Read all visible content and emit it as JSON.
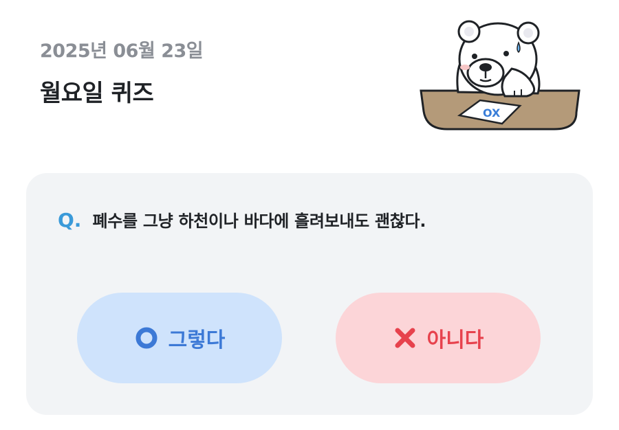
{
  "header": {
    "date": "2025년 06월 23일",
    "title": "월요일 퀴즈"
  },
  "mascot": {
    "icon": "bear-mascot-icon",
    "paper_text": "OX"
  },
  "quiz": {
    "q_mark": "Q.",
    "question": "폐수를 그냥 하천이나 바다에 흘려보내도 괜찮다.",
    "answers": [
      {
        "label": "그렇다",
        "icon": "circle-o-icon",
        "color": "#3c79d6",
        "background": "#cfe3fc"
      },
      {
        "label": "아니다",
        "icon": "cross-x-icon",
        "color": "#e7424d",
        "background": "#fcd5d8"
      }
    ]
  },
  "colors": {
    "accent": "#3a9ad9",
    "card_background": "#f2f4f6",
    "date_text": "#8a8e95",
    "title_text": "#1f2226"
  }
}
